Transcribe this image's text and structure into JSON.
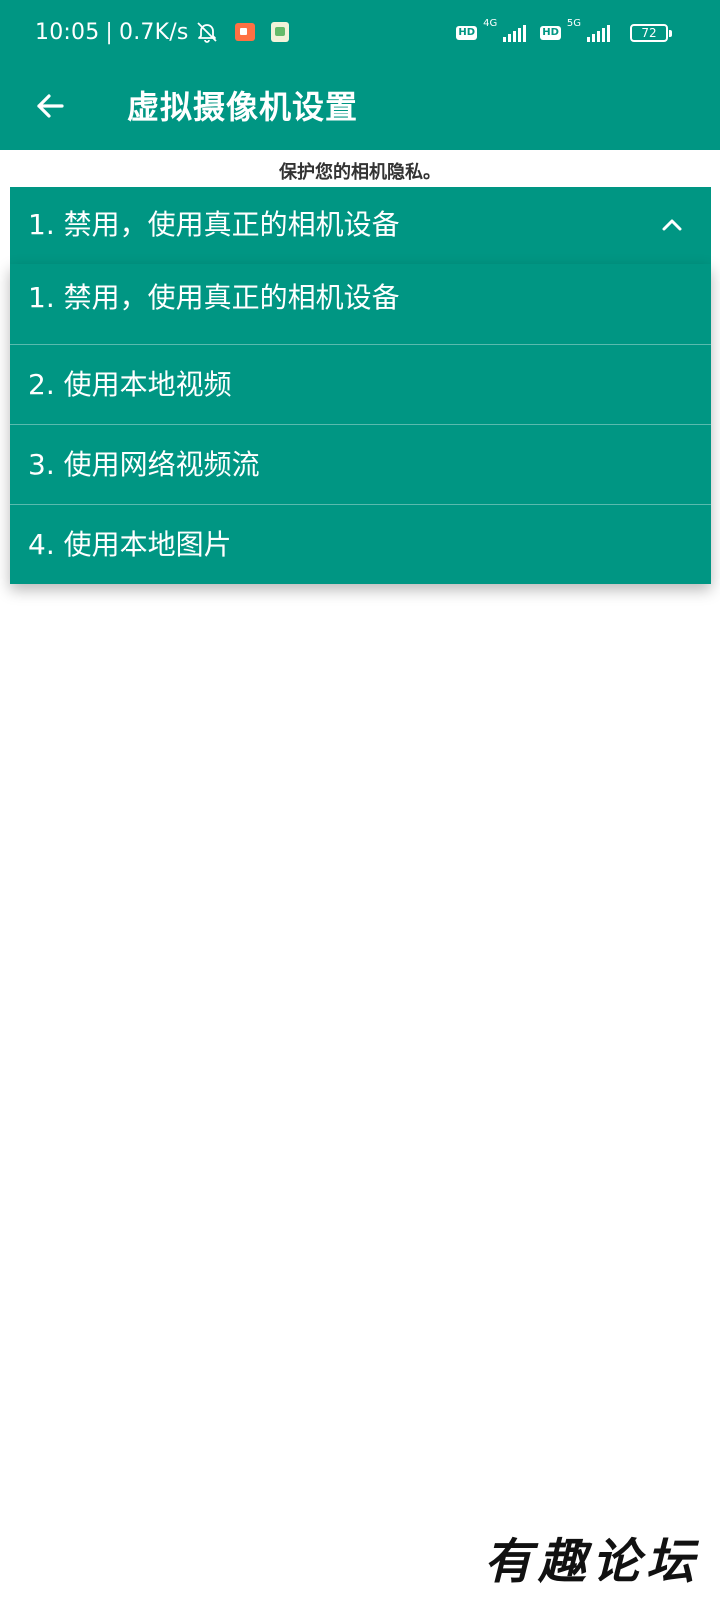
{
  "status_bar": {
    "time": "10:05",
    "separator": "|",
    "network_speed": "0.7K/s",
    "hd_badge_1": "HD",
    "network_1": "4G",
    "hd_badge_2": "HD",
    "network_2": "5G",
    "battery_level": "72",
    "icons": [
      "mute-bell-icon",
      "screen-record-icon",
      "app-notification-icon",
      "signal-icon",
      "battery-icon"
    ]
  },
  "app_bar": {
    "title": "虚拟摄像机设置",
    "back_icon": "arrow-left-icon"
  },
  "subtitle": "保护您的相机隐私。",
  "spinner": {
    "selected_value": "1. 禁用，使用真正的相机设备",
    "expanded": true,
    "icon": "chevron-up-icon"
  },
  "dropdown": {
    "options": [
      "1. 禁用，使用真正的相机设备",
      "2. 使用本地视频",
      "3. 使用网络视频流",
      "4. 使用本地图片"
    ]
  },
  "watermark": "有趣论坛",
  "colors": {
    "primary": "#009683",
    "background": "#ffffff",
    "subtitle_text": "#333333"
  }
}
